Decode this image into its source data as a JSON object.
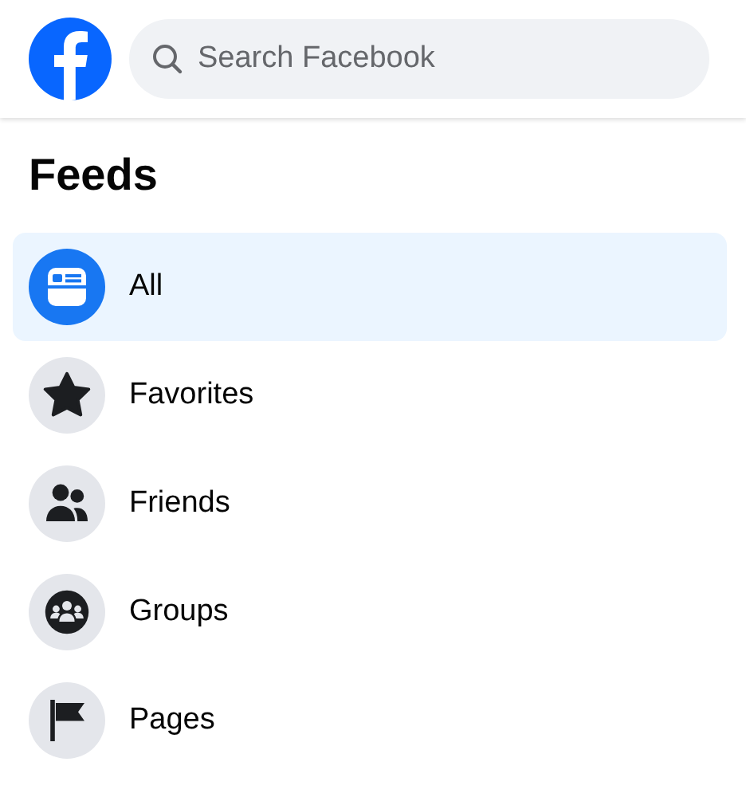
{
  "header": {
    "search": {
      "placeholder": "Search Facebook"
    }
  },
  "feeds": {
    "title": "Feeds",
    "items": [
      {
        "label": "All",
        "selected": true
      },
      {
        "label": "Favorites",
        "selected": false
      },
      {
        "label": "Friends",
        "selected": false
      },
      {
        "label": "Groups",
        "selected": false
      },
      {
        "label": "Pages",
        "selected": false
      }
    ]
  }
}
